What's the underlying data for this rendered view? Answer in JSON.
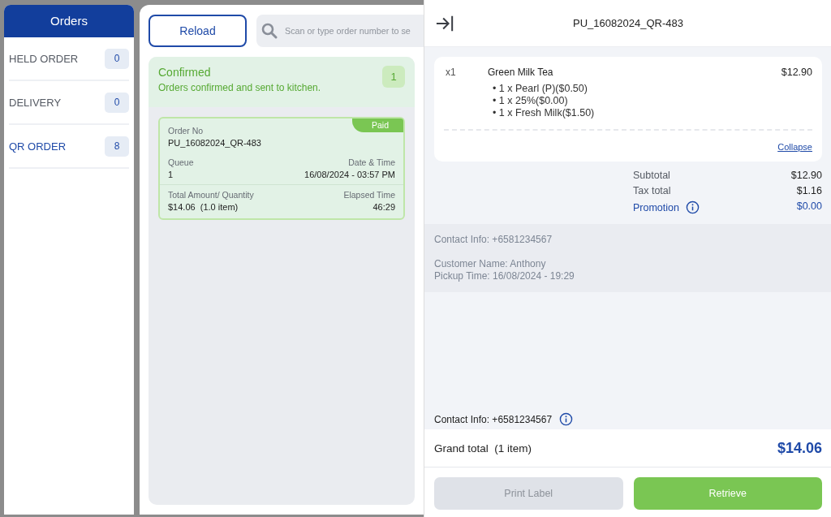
{
  "sidebar": {
    "title": "Orders",
    "items": [
      {
        "label": "HELD ORDER",
        "count": "0",
        "selected": false
      },
      {
        "label": "DELIVERY",
        "count": "0",
        "selected": false
      },
      {
        "label": "QR ORDER",
        "count": "8",
        "selected": true
      }
    ]
  },
  "toolbar": {
    "reload": "Reload",
    "search_placeholder": "Scan or type order number to se"
  },
  "group": {
    "title": "Confirmed",
    "subtitle": "Orders confirmed and sent to kitchen.",
    "count": "1",
    "orders": [
      {
        "badge": "Paid",
        "order_no_label": "Order No",
        "order_no": "PU_16082024_QR-483",
        "queue_label": "Queue",
        "queue": "1",
        "date_label": "Date & Time",
        "date": "16/08/2024 - 03:57 PM",
        "amount_label": "Total Amount/ Quantity",
        "amount": "$14.06  (1.0 item)",
        "elapsed_label": "Elapsed Time",
        "elapsed": "46:29"
      }
    ]
  },
  "detail": {
    "title": "PU_16082024_QR-483",
    "items": [
      {
        "qty": "x1",
        "name": "Green Milk Tea",
        "price": "$12.90",
        "modifiers": [
          "• 1 x Pearl (P)($0.50)",
          "• 1 x 25%($0.00)",
          "• 1 x Fresh Milk($1.50)"
        ]
      }
    ],
    "collapse": "Collapse",
    "totals": [
      {
        "label": "Subtotal",
        "value": "$12.90",
        "kind": "plain"
      },
      {
        "label": "Tax total",
        "value": "$1.16",
        "kind": "plain"
      },
      {
        "label": "Promotion",
        "value": "$0.00",
        "kind": "promo"
      }
    ],
    "info": [
      "Contact Info: +6581234567",
      "Customer Name: Anthony",
      "Pickup Time: 16/08/2024 - 19:29"
    ],
    "contact": "Contact Info: +6581234567",
    "grand_label": "Grand total  (1 item)",
    "grand_value": "$14.06",
    "buttons": [
      {
        "label": "Print Label",
        "disabled": true
      },
      {
        "label": "Retrieve",
        "disabled": false
      }
    ]
  }
}
